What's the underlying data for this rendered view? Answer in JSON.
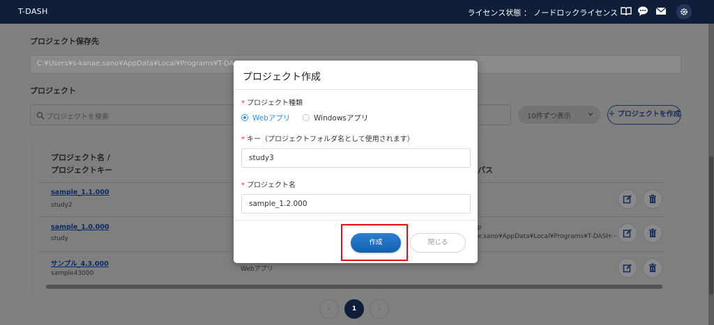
{
  "app": {
    "title": "T-DASH"
  },
  "header": {
    "license_text": "ライセンス状態 ： ノードロックライセンス"
  },
  "storage": {
    "label": "プロジェクト保存先",
    "path": "C:¥Users¥s-kanae.sano¥AppData¥Local¥Programs¥T-DASH"
  },
  "projects": {
    "label": "プロジェクト",
    "search_placeholder": "プロジェクトを検索",
    "per_page": "10件ずつ表示",
    "create_button": "＋ プロジェクトを作成",
    "col_name_line1": "プロジェクト名 /",
    "col_name_line2": "プロジェクトキー",
    "col_path": "パス",
    "rows": [
      {
        "name": "sample_1.1.000",
        "key": "study2",
        "type": "",
        "path1": "",
        "path2": ""
      },
      {
        "name": "sample_1.0.000",
        "key": "study",
        "type": "",
        "path1": "p",
        "path2": "e.sano¥AppData¥Local¥Programs¥T-DASH···"
      },
      {
        "name": "サンプル_4.3.000",
        "key": "sample43000",
        "type": "Webアプリ",
        "path1": "",
        "path2": ""
      }
    ]
  },
  "pagination": {
    "prev": "‹",
    "current": "1",
    "next": "›"
  },
  "modal": {
    "title": "プロジェクト作成",
    "req": "*",
    "type_label": "プロジェクト種類",
    "type_options": [
      "Webアプリ",
      "Windowsアプリ"
    ],
    "selected_type": "Webアプリ",
    "key_label": "キー（プロジェクトフォルダ名として使用されます）",
    "key_value": "study3",
    "name_label": "プロジェクト名",
    "name_value": "sample_1.2.000",
    "submit_label": "作成",
    "close_label": "閉じる"
  },
  "colors": {
    "topbar": "#0f1f3a",
    "accent": "#2b8fe6",
    "primary_button": "#1a6fc0",
    "highlight": "#e01010"
  }
}
